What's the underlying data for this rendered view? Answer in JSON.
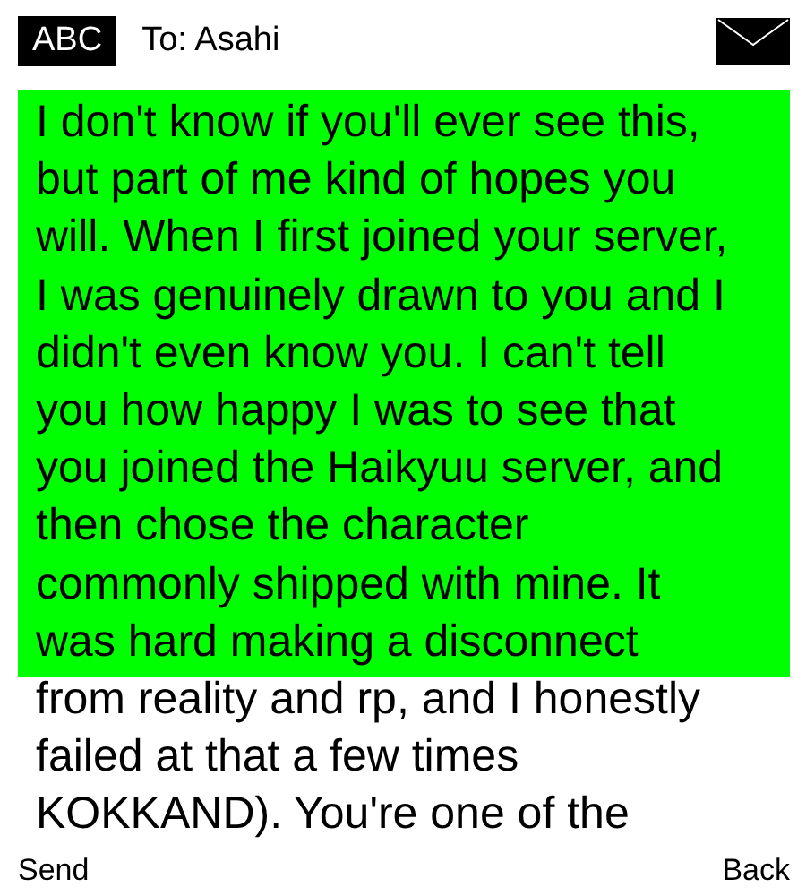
{
  "header": {
    "input_mode": "ABC",
    "recipient": "To: Asahi"
  },
  "message": "I don't know if you'll ever see this,\nbut part of me kind of hopes you\nwill. When I first joined your server,\nI was genuinely drawn to you and I\ndidn't even know you. I can't tell\nyou how happy I was to see that\nyou joined the Haikyuu server, and\nthen chose the character\ncommonly shipped with mine. It\nwas hard making a disconnect\nfrom reality and rp, and I honestly\nfailed at that a few times\nKOKKAND). You're one of the",
  "softkeys": {
    "left": "Send",
    "right": "Back"
  }
}
